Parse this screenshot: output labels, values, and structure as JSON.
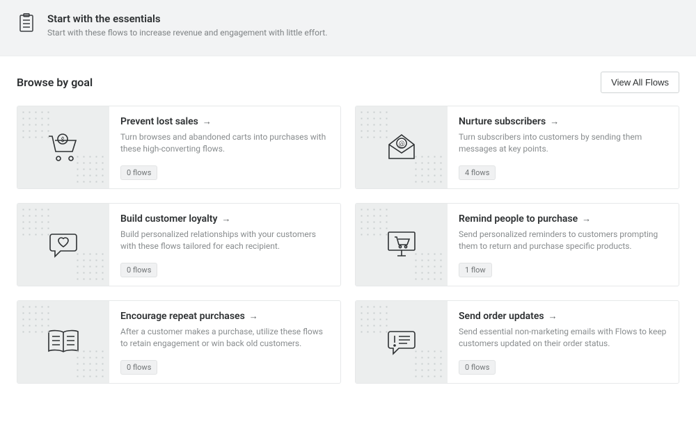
{
  "banner": {
    "title": "Start with the essentials",
    "subtitle": "Start with these flows to increase revenue and engagement with little effort."
  },
  "section": {
    "title": "Browse by goal",
    "view_all_label": "View All Flows"
  },
  "cards": [
    {
      "title": "Prevent lost sales",
      "desc": "Turn browses and abandoned carts into purchases with these high-converting flows.",
      "badge": "0 flows",
      "icon": "cart-dollar"
    },
    {
      "title": "Nurture subscribers",
      "desc": "Turn subscribers into customers by sending them messages at key points.",
      "badge": "4 flows",
      "icon": "envelope-at"
    },
    {
      "title": "Build customer loyalty",
      "desc": "Build personalized relationships with your customers with these flows tailored for each recipient.",
      "badge": "0 flows",
      "icon": "chat-heart"
    },
    {
      "title": "Remind people to purchase",
      "desc": "Send personalized reminders to customers prompting them to return and purchase specific products.",
      "badge": "1 flow",
      "icon": "monitor-cart"
    },
    {
      "title": "Encourage repeat purchases",
      "desc": "After a customer makes a purchase, utilize these flows to retain engagement or win back old customers.",
      "badge": "0 flows",
      "icon": "open-book"
    },
    {
      "title": "Send order updates",
      "desc": "Send essential non-marketing emails with Flows to keep customers updated on their order status.",
      "badge": "0 flows",
      "icon": "chat-alert"
    }
  ]
}
